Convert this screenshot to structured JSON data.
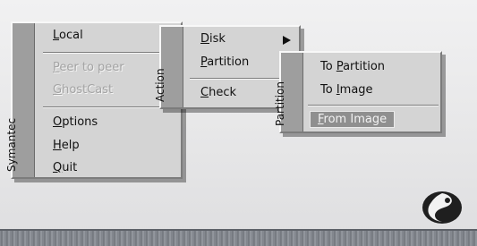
{
  "main_menu": {
    "side_label": "Symantec",
    "items": [
      {
        "pre": "",
        "u": "L",
        "post": "ocal"
      },
      {
        "pre": "",
        "u": "P",
        "post": "eer to peer"
      },
      {
        "pre": "",
        "u": "G",
        "post": "hostCast"
      },
      {
        "pre": "",
        "u": "O",
        "post": "ptions"
      },
      {
        "pre": "",
        "u": "H",
        "post": "elp"
      },
      {
        "pre": "",
        "u": "Q",
        "post": "uit"
      }
    ]
  },
  "action_menu": {
    "side_label": "Action",
    "items": [
      {
        "pre": "",
        "u": "D",
        "post": "isk"
      },
      {
        "pre": "",
        "u": "P",
        "post": "artition"
      },
      {
        "pre": "",
        "u": "C",
        "post": "heck"
      }
    ]
  },
  "partition_menu": {
    "side_label": "Partition",
    "items": [
      {
        "pre": "To ",
        "u": "P",
        "post": "artition"
      },
      {
        "pre": "To ",
        "u": "I",
        "post": "mage"
      },
      {
        "pre": "",
        "u": "F",
        "post": "rom Image"
      }
    ]
  },
  "icons": {
    "logo": "symantec-yin-yang-logo",
    "submenu_arrow": "arrow-right-icon"
  }
}
